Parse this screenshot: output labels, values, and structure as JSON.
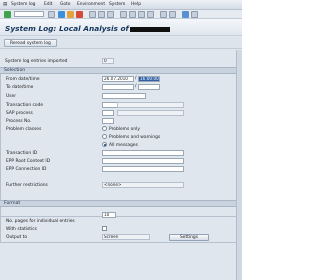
{
  "menubar": {
    "items": [
      "System log",
      "Edit",
      "Goto",
      "Environment",
      "System",
      "Help"
    ]
  },
  "title": {
    "prefix": "System Log: Local Analysis of"
  },
  "apptoolbar": {
    "reread_label": "Reread system log"
  },
  "fields": {
    "entries_imported_label": "System log entries imported",
    "entries_imported_value": "0"
  },
  "selection": {
    "heading": "Selection",
    "from_label": "From date/time",
    "from_date": "26.07.2010",
    "from_time": "16:00:00",
    "to_label": "To date/time",
    "to_date": "",
    "to_time": "",
    "user_label": "User",
    "tcode_label": "Transaction code",
    "sap_process_label": "SAP process",
    "process_no_label": "Process No.",
    "problem_classes_label": "Problem classes",
    "radio_problems_only": "Problems only",
    "radio_problems_warnings": "Problems and warnings",
    "radio_all_messages": "All messages",
    "transaction_id_label": "Transaction ID",
    "epp_root_label": "EPP Root Context ID",
    "epp_connection_label": "EPP Connection ID",
    "further_restrictions_label": "Further restrictions",
    "further_restrictions_value": "<none>"
  },
  "format": {
    "heading": "Format",
    "pages_label": "No. pages for individual entries",
    "pages_value": "10",
    "with_statistics_label": "With statistics",
    "output_to_label": "Output to",
    "output_to_value": "Screen",
    "settings_label": "Settings"
  }
}
